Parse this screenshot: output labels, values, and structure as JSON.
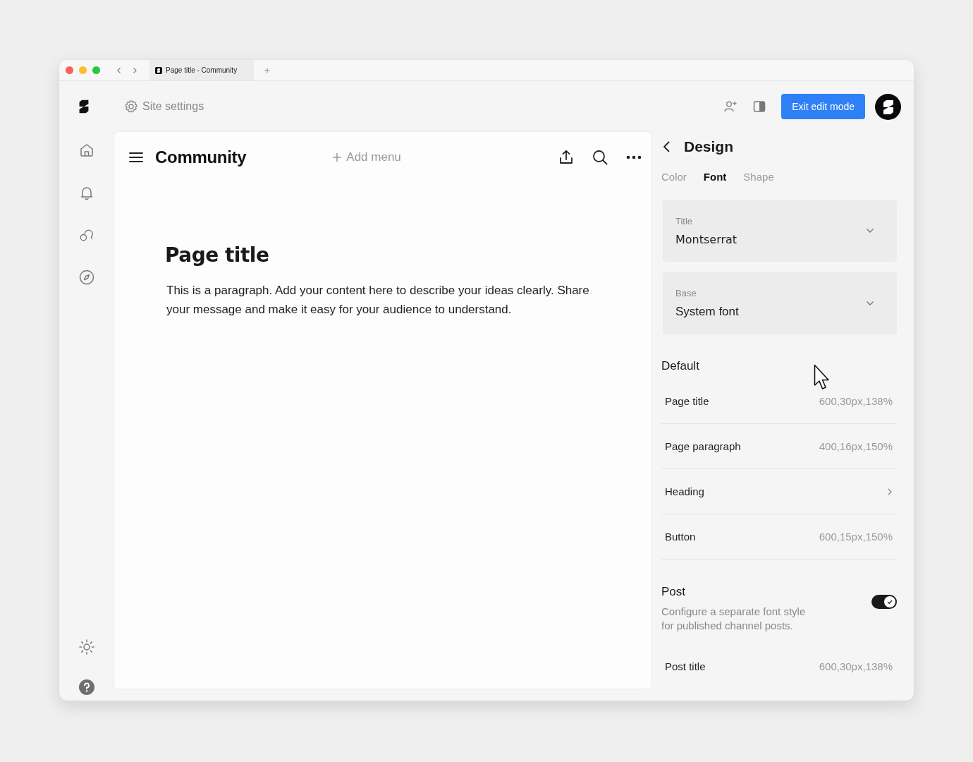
{
  "browser": {
    "tab_title": "Page title - Community"
  },
  "header": {
    "settings_label": "Site settings",
    "exit_button": "Exit edit mode"
  },
  "page": {
    "site_name": "Community",
    "add_menu": "Add menu",
    "title": "Page title",
    "paragraph": "This is a paragraph. Add your content here to describe your ideas clearly. Share your message and make it easy for your audience to understand."
  },
  "panel": {
    "title": "Design",
    "tabs": [
      {
        "label": "Color",
        "selected": false
      },
      {
        "label": "Font",
        "selected": true
      },
      {
        "label": "Shape",
        "selected": false
      }
    ],
    "selects": [
      {
        "label": "Title",
        "value": "Montserrat"
      },
      {
        "label": "Base",
        "value": "System font"
      }
    ],
    "default": {
      "heading": "Default",
      "rows": [
        {
          "kind": "value",
          "name": "Page title",
          "value": "600,30px,138%"
        },
        {
          "kind": "value",
          "name": "Page paragraph",
          "value": "400,16px,150%"
        },
        {
          "kind": "link",
          "name": "Heading"
        },
        {
          "kind": "value",
          "name": "Button",
          "value": "600,15px,150%"
        }
      ]
    },
    "post": {
      "heading": "Post",
      "description": "Configure a separate font style for published channel posts.",
      "on": true,
      "rows": [
        {
          "kind": "value",
          "name": "Post title",
          "value": "600,30px,138%"
        }
      ]
    }
  }
}
